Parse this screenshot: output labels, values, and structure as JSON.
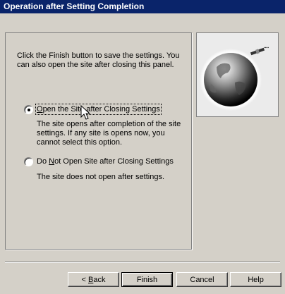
{
  "window": {
    "title": "Operation after Setting Completion"
  },
  "intro": {
    "text": "Click the Finish button to save the settings. You can also open the site after closing this panel."
  },
  "options": [
    {
      "label_pre": "",
      "label_key": "O",
      "label_post": "pen the Site after Closing Settings",
      "selected": true,
      "description": "The site opens after completion of the site settings. If any site is opens now, you cannot select this option."
    },
    {
      "label_pre": "Do ",
      "label_key": "N",
      "label_post": "ot Open Site after Closing Settings",
      "selected": false,
      "description": "The site does not open after settings."
    }
  ],
  "buttons": {
    "back_pre": "< ",
    "back_key": "B",
    "back_post": "ack",
    "finish": "Finish",
    "cancel": "Cancel",
    "help": "Help"
  },
  "icons": {
    "illustration": "globe-satellite-illustration",
    "cursor": "mouse-pointer-icon"
  },
  "colors": {
    "titlebar": "#0a246a",
    "dialog_bg": "#d4d0c8"
  }
}
